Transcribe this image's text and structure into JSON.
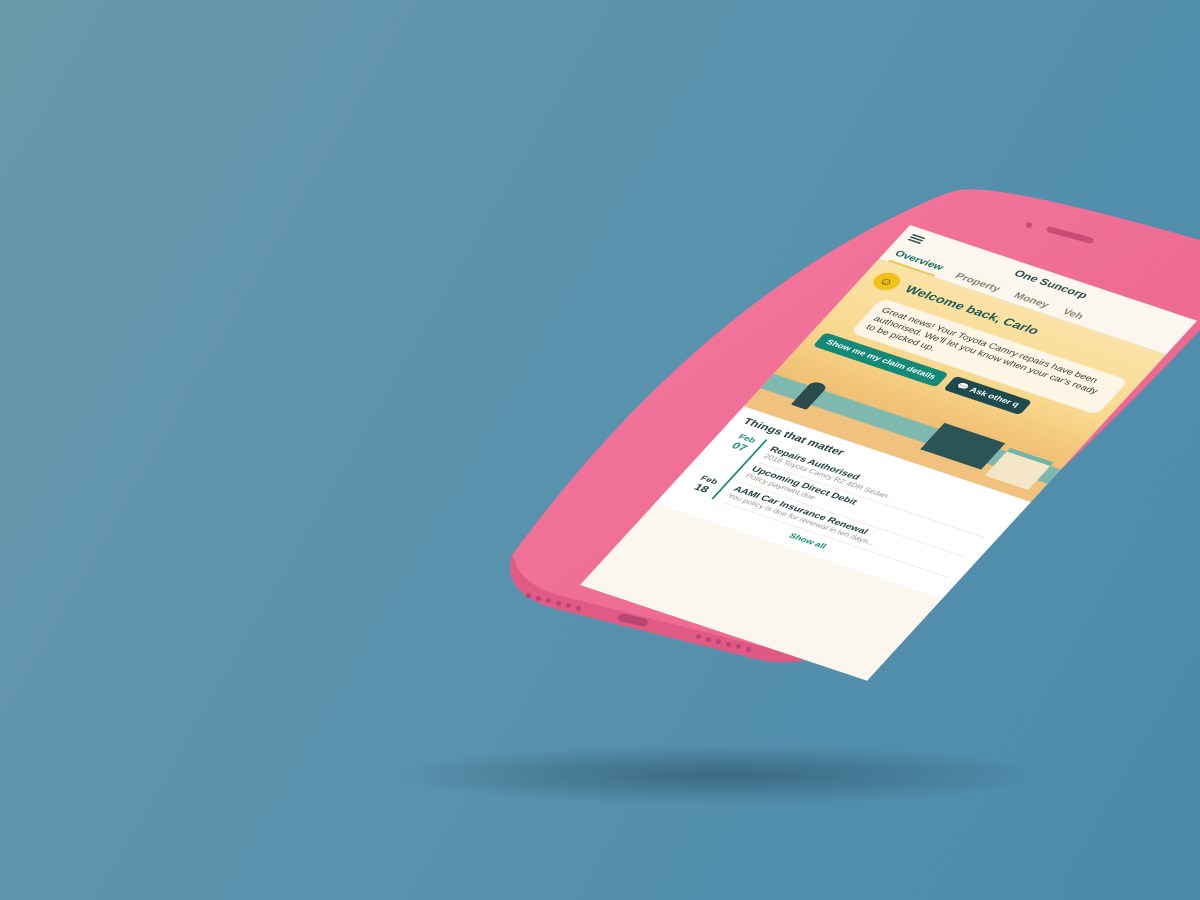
{
  "device": {
    "color": "#ee6b93",
    "background": "#5a93ad"
  },
  "app": {
    "title": "One Suncorp",
    "menu_icon": "hamburger-menu-icon",
    "profile_icon": "profile-icon"
  },
  "tabs": [
    {
      "label": "Overview",
      "active": true
    },
    {
      "label": "Property",
      "active": false
    },
    {
      "label": "Money",
      "active": false
    },
    {
      "label": "Veh",
      "active": false
    }
  ],
  "welcome": {
    "greeting": "Welcome back, Carlo",
    "message": "Great news! Your Toyota Camry repairs have been authorised. We'll let you know when your car's ready to be picked up."
  },
  "actions": {
    "primary_label": "Show me my claim details",
    "secondary_label": "Ask other q"
  },
  "things": {
    "title": "Things that matter",
    "dates": [
      {
        "month": "Feb",
        "day": "07"
      },
      {
        "month": "Feb",
        "day": "18"
      }
    ],
    "events": [
      {
        "title": "Repairs Authorised",
        "sub": "2016 Toyota Camry RZ 4DR Sedan"
      },
      {
        "title": "Upcoming Direct Debit",
        "sub": "Policy payment due"
      },
      {
        "title": "AAMI Car Insurance Renewal",
        "sub": "You policy is due for renewal in ten days..."
      }
    ],
    "show_all_label": "Show all"
  }
}
